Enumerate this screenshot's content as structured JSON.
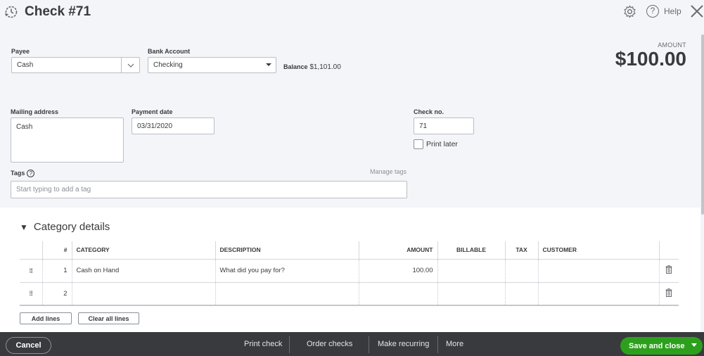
{
  "header": {
    "title": "Check #71",
    "title_icon": "recent-transactions-icon",
    "help_label": "Help"
  },
  "amount": {
    "label": "AMOUNT",
    "value": "$100.00"
  },
  "form": {
    "payee": {
      "label": "Payee",
      "value": "Cash"
    },
    "bank_account": {
      "label": "Bank Account",
      "value": "Checking"
    },
    "balance": {
      "label": "Balance",
      "value": "$1,101.00"
    },
    "mailing_address": {
      "label": "Mailing address",
      "value": "Cash"
    },
    "payment_date": {
      "label": "Payment date",
      "value": "03/31/2020"
    },
    "check_no": {
      "label": "Check no.",
      "value": "71"
    },
    "print_later": {
      "label": "Print later",
      "checked": false
    },
    "tags": {
      "label": "Tags",
      "placeholder": "Start typing to add a tag",
      "manage_label": "Manage tags"
    }
  },
  "category_details": {
    "title": "Category details",
    "columns": [
      "#",
      "CATEGORY",
      "DESCRIPTION",
      "AMOUNT",
      "BILLABLE",
      "TAX",
      "CUSTOMER"
    ],
    "rows": [
      {
        "num": "1",
        "category": "Cash on Hand",
        "description": "",
        "description_placeholder": "What did you pay for?",
        "amount": "100.00",
        "billable": "",
        "tax": "",
        "customer": ""
      },
      {
        "num": "2",
        "category": "",
        "description": "",
        "description_placeholder": "",
        "amount": "",
        "billable": "",
        "tax": "",
        "customer": ""
      }
    ],
    "add_lines_label": "Add lines",
    "clear_lines_label": "Clear all lines"
  },
  "footer": {
    "cancel_label": "Cancel",
    "print_check_label": "Print check",
    "order_checks_label": "Order checks",
    "make_recurring_label": "Make recurring",
    "more_label": "More",
    "save_label": "Save and close"
  },
  "colors": {
    "primary_green": "#2ca01c",
    "footer_bg": "#393a3d",
    "page_bg": "#f4f5f8"
  }
}
